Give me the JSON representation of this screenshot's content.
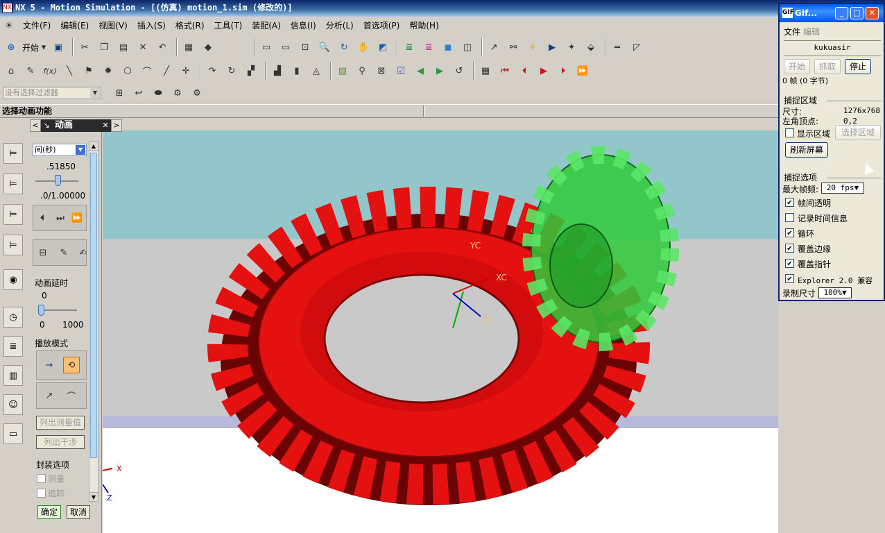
{
  "window": {
    "title": "NX 5 - Motion Simulation - [(仿真) motion_1.sim (修改的)]",
    "app_icon": "NX"
  },
  "menu": [
    "文件(F)",
    "编辑(E)",
    "视图(V)",
    "插入(S)",
    "格式(R)",
    "工具(T)",
    "装配(A)",
    "信息(I)",
    "分析(L)",
    "首选项(P)",
    "帮助(H)"
  ],
  "toolbar1": {
    "start_label": "开始"
  },
  "filter": {
    "placeholder": "没有选择过滤器"
  },
  "status": {
    "prompt": "选择动画功能"
  },
  "axes": {
    "xc": "XC",
    "yc": "YC",
    "zc": "ZC",
    "x": "X",
    "z": "Z"
  },
  "panel": {
    "title": "动画",
    "time_select": "间(秒)",
    "time_value": ".51850",
    "time_range": ".0/1.00000",
    "time_fraction": 0.5185,
    "delay_label": "动画延时",
    "delay_value": "0",
    "delay_min": "0",
    "delay_max": "1000",
    "delay_fraction": 0,
    "play_mode_label": "播放模式",
    "list_measure": "列出测量值",
    "list_interference": "列出干涉",
    "wrap_label": "封装选项",
    "measure_chk": "测量",
    "trace_chk": "追踪",
    "ok": "确定",
    "cancel": "取消"
  },
  "gif": {
    "title": "Gif...",
    "menu_file": "文件",
    "menu_edit": "编辑",
    "user": "kukuasir",
    "start": "开始",
    "capture": "抓取",
    "stop": "停止",
    "frames": "0 帧 (0 字节)",
    "capture_area": "捕捉区域",
    "size_label": "尺寸:",
    "size_value": "1276x768",
    "corner_label": "左角顶点:",
    "corner_value": "0,2",
    "show_area": "显示区域",
    "select_area": "选择区域",
    "refresh": "刷新屏幕",
    "capture_options": "捕捉选项",
    "max_fps_label": "最大帧频:",
    "max_fps_value": "20 fps",
    "options": [
      {
        "label": "帧间透明",
        "checked": true
      },
      {
        "label": "记录时间信息",
        "checked": false
      },
      {
        "label": "循环",
        "checked": true
      },
      {
        "label": "覆盖边缘",
        "checked": true
      },
      {
        "label": "覆盖指针",
        "checked": true
      },
      {
        "label": "Explorer 2.0 兼容",
        "checked": true
      }
    ],
    "record_size_label": "录制尺寸",
    "record_size_value": "100%"
  },
  "colors": {
    "gear_red": "#e51010",
    "gear_dark": "#6a0404",
    "gear_green": "#2fc93a"
  }
}
